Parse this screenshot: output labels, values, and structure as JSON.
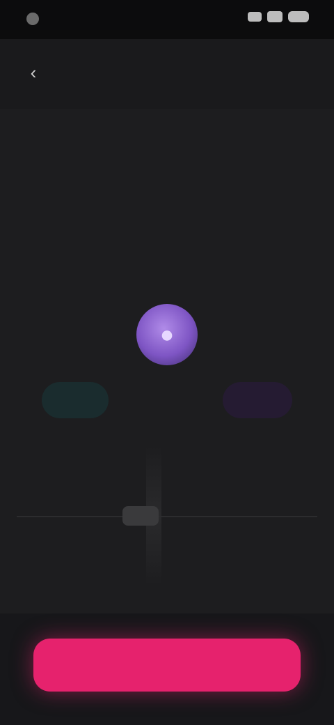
{
  "status_bar": {
    "time": ""
  },
  "app_bar": {
    "title": ""
  },
  "details": [
    {
      "label": "",
      "value": ""
    },
    {
      "label": "",
      "value": ""
    },
    {
      "label": "",
      "value": ""
    }
  ],
  "section": {
    "label": ""
  },
  "recipient": {
    "name": ""
  },
  "amount": {
    "chip": "",
    "text": ""
  },
  "cta": {
    "label": ""
  },
  "colors": {
    "background": "#1d1d1f",
    "accent": "#e6226d",
    "avatar": "#7e55c4"
  }
}
